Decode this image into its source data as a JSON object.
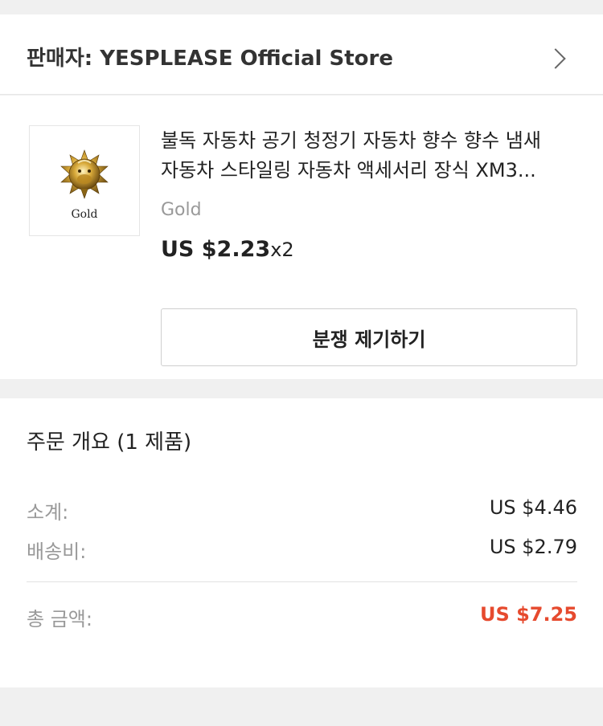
{
  "seller": {
    "label": "판매자: YESPLEASE Official Store"
  },
  "product": {
    "image_caption": "Gold",
    "title_line1": "불독 자동차 공기 청정기 자동차 향수 향수 냄새",
    "title_line2": "자동차 스타일링 자동차 액세서리 장식 XM3...",
    "variant": "Gold",
    "price": "US $2.23",
    "quantity": "x2",
    "dispute_button": "분쟁 제기하기"
  },
  "summary": {
    "title": "주문 개요 (1 제품)",
    "subtotal_label": "소계:",
    "subtotal_value": "US $4.46",
    "shipping_label": "배송비:",
    "shipping_value": "US $2.79",
    "total_label": "총 금액:",
    "total_value": "US $7.25"
  },
  "colors": {
    "total_accent": "#e64a2e",
    "background": "#f0f0f0"
  },
  "icons": {
    "seller_chevron": "chevron-right-icon",
    "product_image": "bulldog-ornament-icon"
  }
}
